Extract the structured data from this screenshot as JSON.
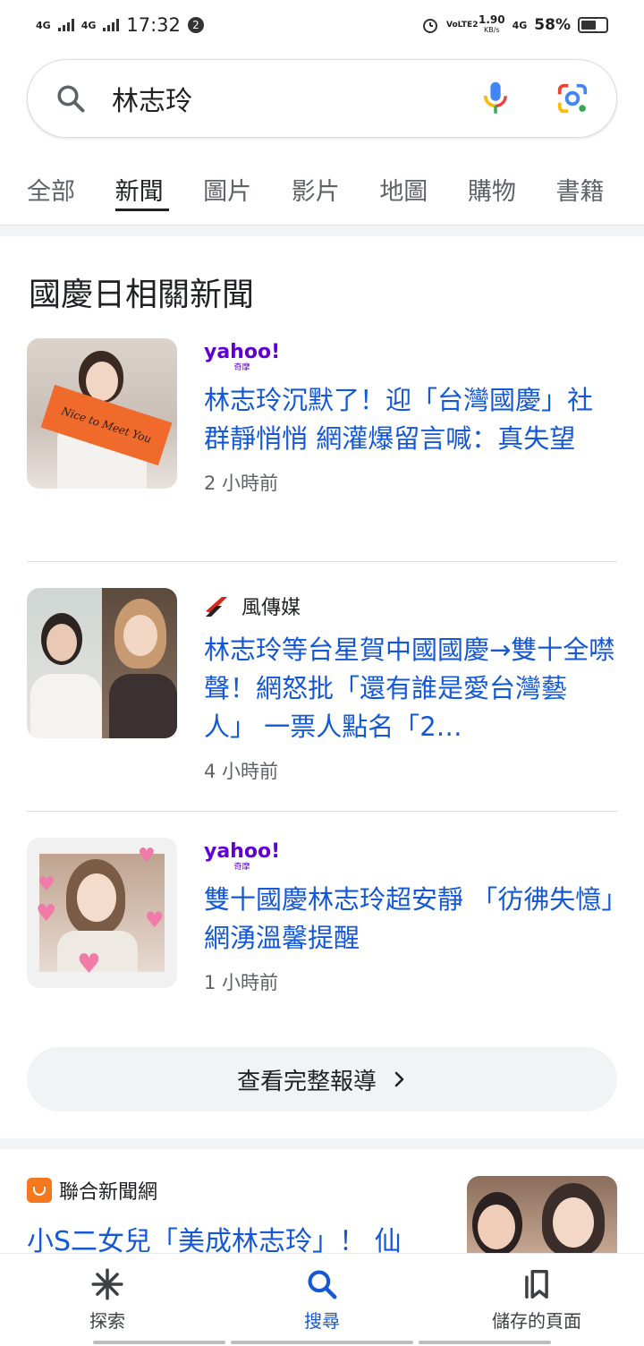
{
  "status_bar": {
    "network_1": "4G",
    "network_2": "4G",
    "time": "17:32",
    "notif_count": "2",
    "volte": "VoLTE2",
    "speed": "1.90",
    "speed_unit": "KB/s",
    "network_3": "4G",
    "battery": "58%"
  },
  "search": {
    "query": "林志玲"
  },
  "tabs": [
    {
      "label": "全部"
    },
    {
      "label": "新聞"
    },
    {
      "label": "圖片"
    },
    {
      "label": "影片"
    },
    {
      "label": "地圖"
    },
    {
      "label": "購物"
    },
    {
      "label": "書籍"
    }
  ],
  "section": {
    "title": "國慶日相關新聞"
  },
  "news": [
    {
      "source": "yahoo!",
      "source_sub": "奇摩",
      "headline": "林志玲沉默了！迎「台灣國慶」社群靜悄悄 網灌爆留言喊：真失望",
      "time": "2 小時前",
      "thumb_text": "Nice to Meet You"
    },
    {
      "source": "風傳媒",
      "headline": "林志玲等台星賀中國國慶→雙十全噤聲！網怒批「還有誰是愛台灣藝人」 一票人點名「2…",
      "time": "4 小時前"
    },
    {
      "source": "yahoo!",
      "source_sub": "奇摩",
      "headline": "雙十國慶林志玲超安靜 「彷彿失憶」網湧溫馨提醒",
      "time": "1 小時前"
    }
  ],
  "full_coverage": {
    "label": "查看完整報導"
  },
  "story2": {
    "source": "聯合新聞網",
    "headline": "小S二女兒「美成林志玲」！ 仙"
  },
  "bottom_nav": [
    {
      "label": "探索",
      "icon": "asterisk-icon"
    },
    {
      "label": "搜尋",
      "icon": "search-icon"
    },
    {
      "label": "儲存的頁面",
      "icon": "bookmarks-icon"
    }
  ],
  "colors": {
    "link": "#1558d6",
    "yahoo": "#6001d2",
    "google_blue": "#4285f4",
    "google_red": "#ea4335",
    "google_yellow": "#fbbc04",
    "google_green": "#34a853"
  }
}
